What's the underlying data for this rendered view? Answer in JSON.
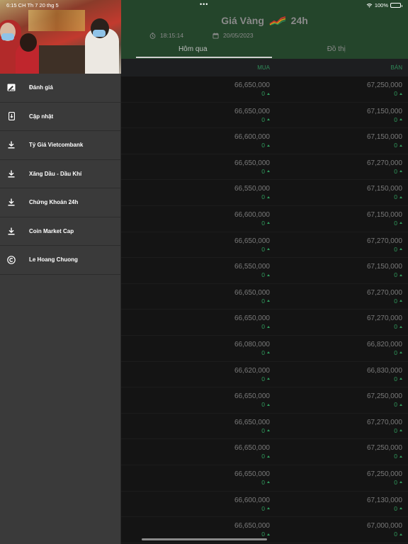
{
  "status_bar": {
    "time_date": "6:15 CH   Th 7 20 thg 5",
    "battery": "100%",
    "wifi_icon": "wifi-icon",
    "battery_icon": "battery-icon"
  },
  "sidebar": {
    "items": [
      {
        "label": "Đánh giá",
        "icon": "rate-icon"
      },
      {
        "label": "Cập nhật",
        "icon": "update-icon"
      },
      {
        "label": "Tỷ Giá Vietcombank",
        "icon": "download-icon"
      },
      {
        "label": "Xăng Dầu - Dầu Khí",
        "icon": "download-icon"
      },
      {
        "label": "Chứng Khoán 24h",
        "icon": "download-icon"
      },
      {
        "label": "Coin Market Cap",
        "icon": "download-icon"
      },
      {
        "label": "Le Hoang Chuong",
        "icon": "copyright-icon"
      }
    ]
  },
  "header": {
    "title_left": "Giá Vàng",
    "title_right": "24h",
    "time": "18:15:14",
    "date": "20/05/2023",
    "colors": {
      "header_bg": "#24452b",
      "accent_green": "#2f9a5c"
    }
  },
  "tabs": [
    {
      "label": "Hôm qua",
      "active": true
    },
    {
      "label": "Đồ thị",
      "active": false
    }
  ],
  "table": {
    "headers": {
      "buy": "MUA",
      "sell": "BÁN"
    },
    "rows": [
      {
        "buy": "66,650,000",
        "buy_change": "0",
        "sell": "67,250,000",
        "sell_change": "0"
      },
      {
        "buy": "66,650,000",
        "buy_change": "0",
        "sell": "67,150,000",
        "sell_change": "0"
      },
      {
        "buy": "66,600,000",
        "buy_change": "0",
        "sell": "67,150,000",
        "sell_change": "0"
      },
      {
        "buy": "66,650,000",
        "buy_change": "0",
        "sell": "67,270,000",
        "sell_change": "0"
      },
      {
        "buy": "66,550,000",
        "buy_change": "0",
        "sell": "67,150,000",
        "sell_change": "0"
      },
      {
        "buy": "66,600,000",
        "buy_change": "0",
        "sell": "67,150,000",
        "sell_change": "0"
      },
      {
        "buy": "66,650,000",
        "buy_change": "0",
        "sell": "67,270,000",
        "sell_change": "0"
      },
      {
        "buy": "66,550,000",
        "buy_change": "0",
        "sell": "67,150,000",
        "sell_change": "0"
      },
      {
        "buy": "66,650,000",
        "buy_change": "0",
        "sell": "67,270,000",
        "sell_change": "0"
      },
      {
        "buy": "66,650,000",
        "buy_change": "0",
        "sell": "67,270,000",
        "sell_change": "0"
      },
      {
        "buy": "66,080,000",
        "buy_change": "0",
        "sell": "66,820,000",
        "sell_change": "0"
      },
      {
        "buy": "66,620,000",
        "buy_change": "0",
        "sell": "66,830,000",
        "sell_change": "0"
      },
      {
        "buy": "66,650,000",
        "buy_change": "0",
        "sell": "67,250,000",
        "sell_change": "0"
      },
      {
        "buy": "66,650,000",
        "buy_change": "0",
        "sell": "67,270,000",
        "sell_change": "0"
      },
      {
        "buy": "66,650,000",
        "buy_change": "0",
        "sell": "67,250,000",
        "sell_change": "0"
      },
      {
        "buy": "66,650,000",
        "buy_change": "0",
        "sell": "67,250,000",
        "sell_change": "0"
      },
      {
        "buy": "66,600,000",
        "buy_change": "0",
        "sell": "67,130,000",
        "sell_change": "0"
      },
      {
        "buy": "66,650,000",
        "buy_change": "0",
        "sell": "67,000,000",
        "sell_change": "0"
      }
    ]
  }
}
